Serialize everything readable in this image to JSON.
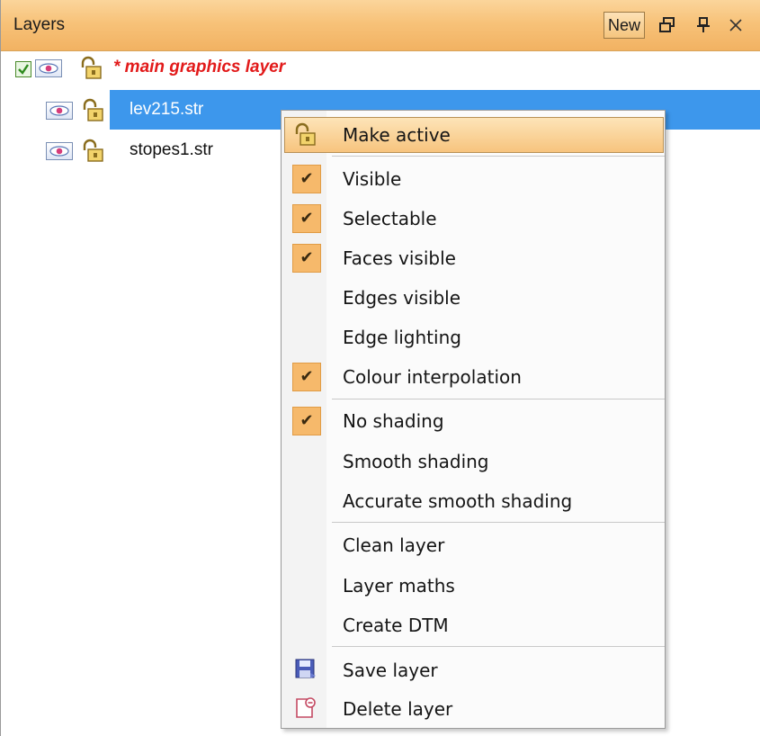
{
  "panel": {
    "title": "Layers",
    "new_button": "New",
    "icons": [
      "restore-icon",
      "pin-icon",
      "close-icon"
    ]
  },
  "tree": {
    "main_layer": "* main graphics layer",
    "items": [
      {
        "label": "lev215.str",
        "selected": true
      },
      {
        "label": "stopes1.str",
        "selected": false
      }
    ]
  },
  "context_menu": {
    "items": [
      {
        "label": "Make active",
        "icon": "lock-icon",
        "highlighted": true
      },
      {
        "label": "Visible",
        "checked": true
      },
      {
        "label": "Selectable",
        "checked": true
      },
      {
        "label": "Faces visible",
        "checked": true
      },
      {
        "label": "Edges visible",
        "checked": false
      },
      {
        "label": "Edge lighting",
        "checked": false
      },
      {
        "label": "Colour interpolation",
        "checked": true
      },
      {
        "label": "No shading",
        "checked": true
      },
      {
        "label": "Smooth shading",
        "checked": false
      },
      {
        "label": "Accurate smooth shading",
        "checked": false
      },
      {
        "label": "Clean layer"
      },
      {
        "label": "Layer maths"
      },
      {
        "label": "Create DTM"
      },
      {
        "label": "Save layer",
        "icon": "save-icon"
      },
      {
        "label": "Delete layer",
        "icon": "delete-icon"
      }
    ]
  },
  "colors": {
    "titlebar": "#f7c279",
    "selection": "#3d97ec",
    "main_layer_text": "#e21a1a"
  }
}
